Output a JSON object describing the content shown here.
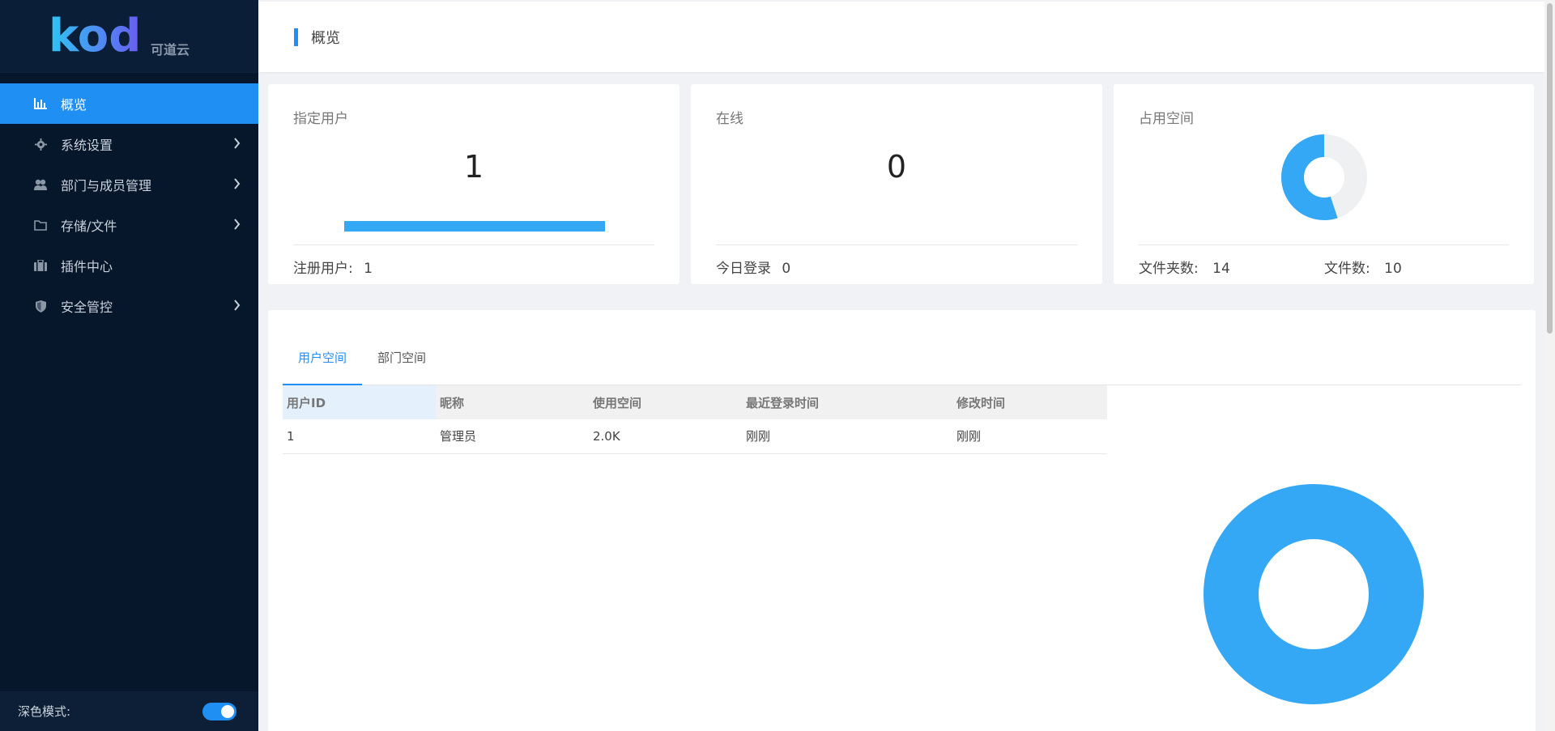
{
  "brand": {
    "logo_text": "kod",
    "logo_subtitle": "可道云"
  },
  "sidebar": {
    "items": [
      {
        "label": "概览",
        "icon": "bar-chart-icon",
        "active": true,
        "has_arrow": false
      },
      {
        "label": "系统设置",
        "icon": "gear-icon",
        "active": false,
        "has_arrow": true
      },
      {
        "label": "部门与成员管理",
        "icon": "users-icon",
        "active": false,
        "has_arrow": true
      },
      {
        "label": "存储/文件",
        "icon": "folder-icon",
        "active": false,
        "has_arrow": true
      },
      {
        "label": "插件中心",
        "icon": "briefcase-icon",
        "active": false,
        "has_arrow": false
      },
      {
        "label": "安全管控",
        "icon": "shield-icon",
        "active": false,
        "has_arrow": true
      }
    ],
    "dark_mode_label": "深色模式:",
    "dark_mode_on": true
  },
  "header": {
    "title": "概览"
  },
  "stats": {
    "users": {
      "title": "指定用户",
      "value": "1",
      "footer_label": "注册用户:",
      "footer_value": "1",
      "progress": 1.0
    },
    "online": {
      "title": "在线",
      "value": "0",
      "footer_label": "今日登录",
      "footer_value": "0"
    },
    "space": {
      "title": "占用空间",
      "folders_label": "文件夹数:",
      "folders_value": "14",
      "files_label": "文件数:",
      "files_value": "10",
      "used_fraction": 0.55
    }
  },
  "tabs": [
    {
      "label": "用户空间",
      "active": true
    },
    {
      "label": "部门空间",
      "active": false
    }
  ],
  "table": {
    "columns": [
      "用户ID",
      "昵称",
      "使用空间",
      "最近登录时间",
      "修改时间"
    ],
    "rows": [
      [
        "1",
        "管理员",
        "2.0K",
        "刚刚",
        "刚刚"
      ]
    ]
  },
  "colors": {
    "accent": "#1f8ff3",
    "chart_blue": "#35a8f5",
    "sidebar_bg": "#06162b",
    "chart_empty": "#eef0f2"
  }
}
